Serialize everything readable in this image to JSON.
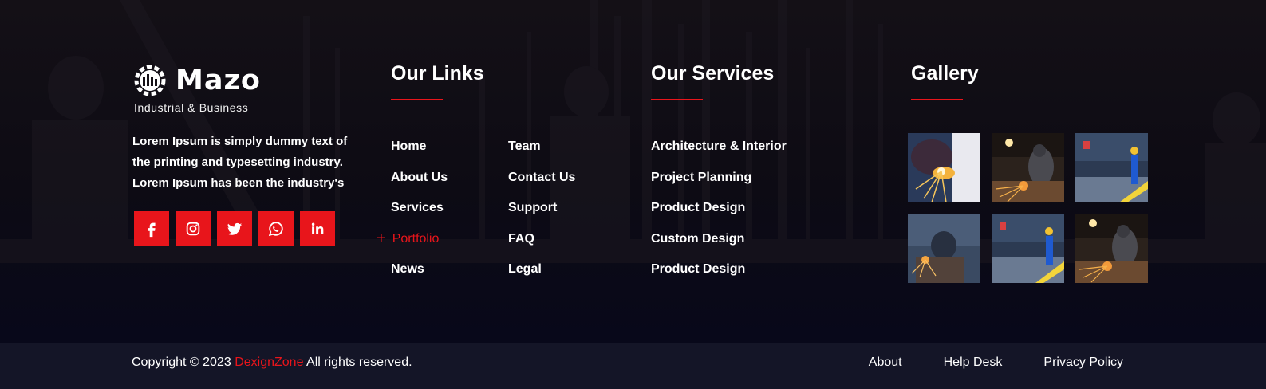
{
  "brand": {
    "name": "Mazo",
    "tagline": "Industrial & Business",
    "description": "Lorem Ipsum is simply dummy text of the printing and typesetting industry. Lorem Ipsum has been the industry's",
    "social": [
      "facebook-icon",
      "instagram-icon",
      "twitter-icon",
      "whatsapp-icon",
      "linkedin-icon"
    ]
  },
  "links": {
    "title": "Our Links",
    "col1": [
      "Home",
      "About Us",
      "Services",
      "Portfolio",
      "News"
    ],
    "col2": [
      "Team",
      "Contact Us",
      "Support",
      "FAQ",
      "Legal"
    ],
    "active": "Portfolio",
    "active_marker": "+"
  },
  "services": {
    "title": "Our Services",
    "items": [
      "Architecture & Interior",
      "Project Planning",
      "Product Design",
      "Custom Design",
      "Product Design"
    ]
  },
  "gallery": {
    "title": "Gallery",
    "images": [
      "welding-sparks-photo",
      "grinder-worker-photo",
      "factory-worker-blue-photo",
      "welding-factory-photo",
      "factory-worker-blue-photo",
      "grinder-worker-photo"
    ]
  },
  "footer": {
    "copyright_prefix": "Copyright © 2023",
    "copyright_brand": "DexignZone",
    "copyright_suffix": "All rights reserved.",
    "links": [
      "About",
      "Help Desk",
      "Privacy Policy"
    ]
  },
  "colors": {
    "accent": "#e8151b",
    "background": "#0c0a14",
    "bottom_bar": "#141527"
  }
}
